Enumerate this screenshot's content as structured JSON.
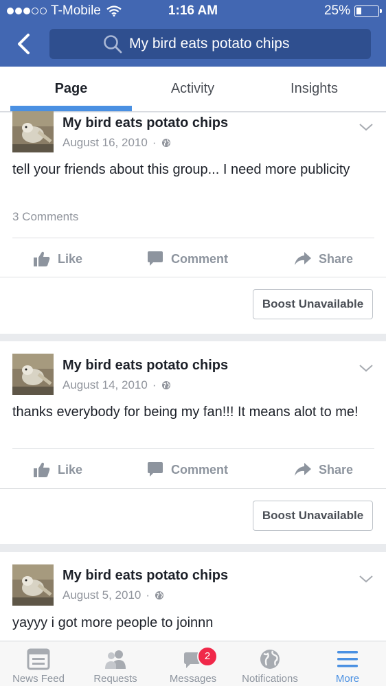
{
  "status_bar": {
    "carrier": "T-Mobile",
    "time": "1:16 AM",
    "battery": "25%"
  },
  "search": {
    "query": "My bird eats potato chips"
  },
  "tabs": [
    {
      "label": "Page"
    },
    {
      "label": "Activity"
    },
    {
      "label": "Insights"
    }
  ],
  "posts": [
    {
      "author": "My bird eats potato chips",
      "date": "August 16, 2010",
      "separator": "·",
      "text": "tell your friends about this group... I need more publicity",
      "comments": "3 Comments",
      "like_label": "Like",
      "comment_label": "Comment",
      "share_label": "Share",
      "boost_label": "Boost Unavailable"
    },
    {
      "author": "My bird eats potato chips",
      "date": "August 14, 2010",
      "separator": "·",
      "text": "thanks everybody for being my fan!!! It means alot to me!",
      "like_label": "Like",
      "comment_label": "Comment",
      "share_label": "Share",
      "boost_label": "Boost Unavailable"
    },
    {
      "author": "My bird eats potato chips",
      "date": "August 5, 2010",
      "separator": "·",
      "text": "yayyy i got more people to joinnn"
    }
  ],
  "bottom_nav": {
    "items": [
      {
        "label": "News Feed",
        "icon": "news-feed-icon"
      },
      {
        "label": "Requests",
        "icon": "friends-icon"
      },
      {
        "label": "Messages",
        "icon": "messages-icon",
        "badge": "2"
      },
      {
        "label": "Notifications",
        "icon": "globe-icon"
      },
      {
        "label": "More",
        "icon": "menu-icon"
      }
    ]
  },
  "colors": {
    "brand_blue": "#4267b2",
    "active_blue": "#4a90e2",
    "badge_red": "#f02849"
  }
}
